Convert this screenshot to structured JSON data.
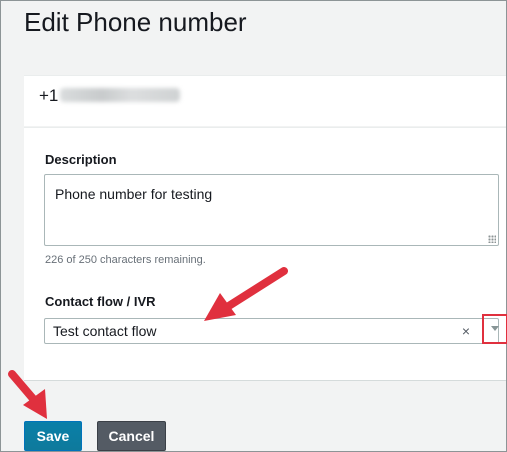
{
  "page": {
    "title": "Edit Phone number"
  },
  "phone": {
    "prefix": "+1"
  },
  "form": {
    "description_label": "Description",
    "description_value": "Phone number for testing",
    "char_count": "226 of 250 characters remaining.",
    "flow_label": "Contact flow / IVR",
    "flow_value": "Test contact flow",
    "clear_glyph": "×"
  },
  "actions": {
    "save_label": "Save",
    "cancel_label": "Cancel"
  },
  "colors": {
    "annotation_red": "#e0303e",
    "primary_button": "#0a7fa8",
    "secondary_button": "#545b64"
  },
  "icons": {
    "clear": "clear-icon",
    "dropdown": "chevron-down-icon",
    "resize": "resize-grip-icon"
  }
}
